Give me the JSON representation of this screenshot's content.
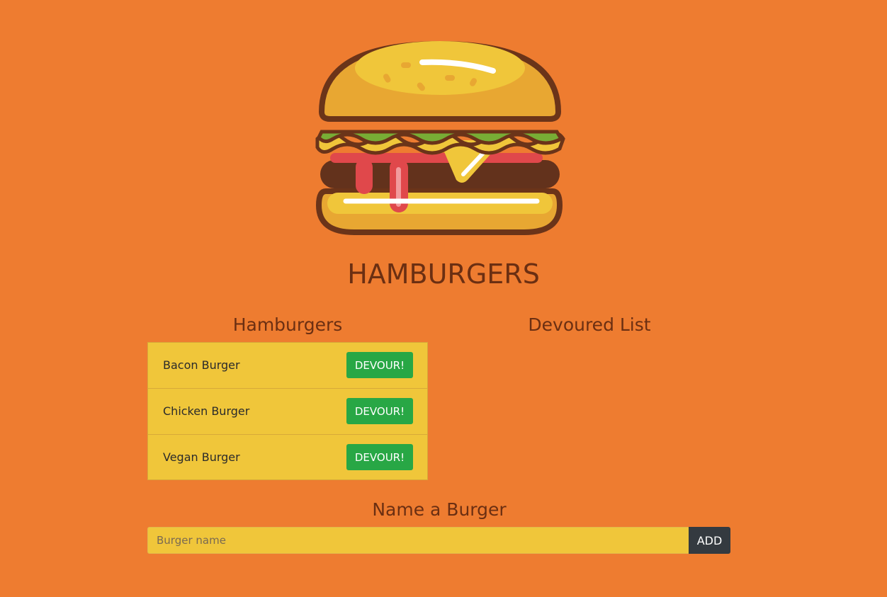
{
  "header": {
    "logo_icon": "hamburger-icon",
    "title": "HAMBURGERS"
  },
  "hamburgers_column": {
    "title": "Hamburgers",
    "items": [
      {
        "name": "Bacon Burger",
        "button_label": "DEVOUR!"
      },
      {
        "name": "Chicken Burger",
        "button_label": "DEVOUR!"
      },
      {
        "name": "Vegan Burger",
        "button_label": "DEVOUR!"
      }
    ]
  },
  "devoured_column": {
    "title": "Devoured List",
    "items": []
  },
  "form": {
    "title": "Name a Burger",
    "input_value": "",
    "input_placeholder": "Burger name",
    "add_label": "ADD"
  },
  "colors": {
    "background": "#ee7c30",
    "list_background": "#f0c63a",
    "devour_button": "#28a745",
    "add_button": "#343a40",
    "heading": "#6b2f12"
  }
}
